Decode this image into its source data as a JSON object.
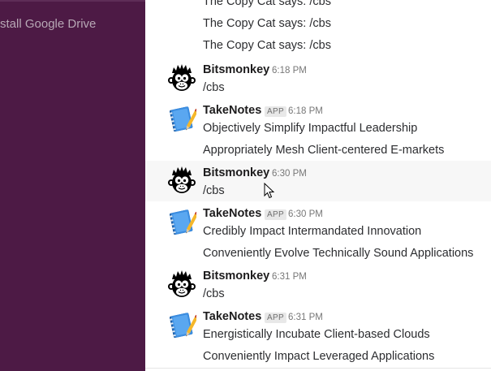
{
  "sidebar": {
    "install_label": "stall Google Drive"
  },
  "messages": {
    "m0": {
      "lines": [
        "The Copy Cat says: /cbs",
        "The Copy Cat says: /cbs",
        "The Copy Cat says: /cbs"
      ]
    },
    "m1": {
      "user": "Bitsmonkey",
      "time": "6:18 PM",
      "lines": [
        "/cbs"
      ]
    },
    "m2": {
      "user": "TakeNotes",
      "badge": "APP",
      "time": "6:18 PM",
      "lines": [
        "Objectively Simplify Impactful Leadership",
        "Appropriately Mesh Client-centered E-markets"
      ]
    },
    "m3": {
      "user": "Bitsmonkey",
      "time": "6:30 PM",
      "lines": [
        "/cbs"
      ]
    },
    "m4": {
      "user": "TakeNotes",
      "badge": "APP",
      "time": "6:30 PM",
      "lines": [
        "Credibly Impact Intermandated Innovation",
        "Conveniently Evolve Technically Sound Applications"
      ]
    },
    "m5": {
      "user": "Bitsmonkey",
      "time": "6:31 PM",
      "lines": [
        "/cbs"
      ]
    },
    "m6": {
      "user": "TakeNotes",
      "badge": "APP",
      "time": "6:31 PM",
      "lines": [
        "Energistically Incubate Client-based Clouds",
        "Conveniently Impact Leveraged Applications"
      ]
    }
  },
  "icons": {
    "bot_avatar": "monkey-avatar-icon",
    "app_avatar": "notebook-pen-icon",
    "pointer": "mouse-pointer-icon"
  }
}
